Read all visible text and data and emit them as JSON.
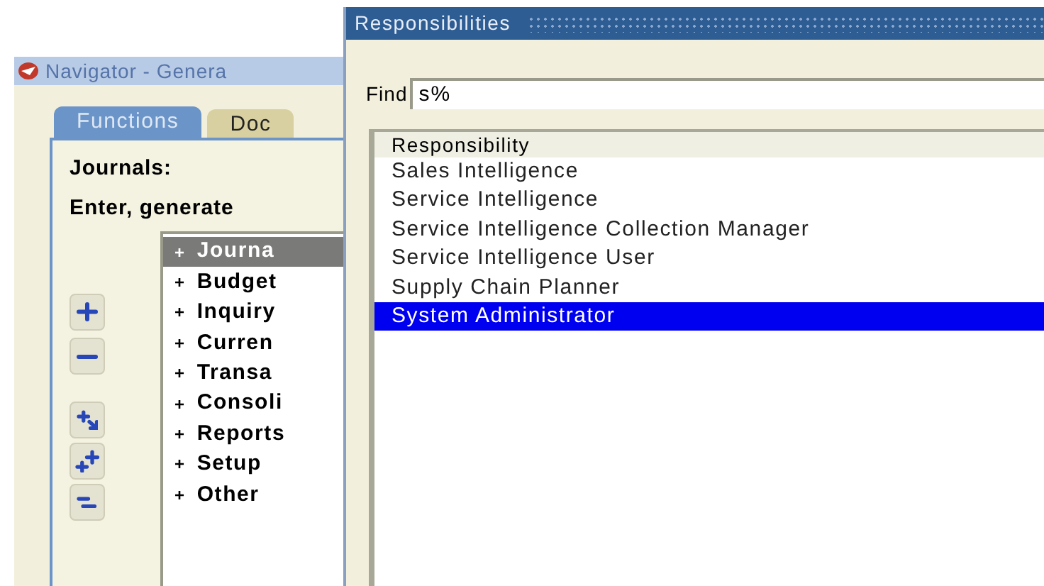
{
  "navigator": {
    "title": "Navigator - Genera",
    "tabs": [
      {
        "label": "Functions",
        "selected": true
      },
      {
        "label": "Doc",
        "selected": false
      }
    ],
    "heading": "Journals:",
    "description": "Enter, generate",
    "tree": [
      {
        "expander": "+",
        "label": "Journa",
        "selected": true
      },
      {
        "expander": "+",
        "label": "Budget",
        "selected": false
      },
      {
        "expander": "+",
        "label": "Inquiry",
        "selected": false
      },
      {
        "expander": "+",
        "label": "Curren",
        "selected": false
      },
      {
        "expander": "+",
        "label": "Transa",
        "selected": false
      },
      {
        "expander": "+",
        "label": "Consoli",
        "selected": false
      },
      {
        "expander": "+",
        "label": "Reports",
        "selected": false
      },
      {
        "expander": "+",
        "label": "Setup",
        "selected": false
      },
      {
        "expander": "+",
        "label": "Other",
        "selected": false
      }
    ],
    "tool_buttons": [
      {
        "kind": "expand"
      },
      {
        "kind": "collapse"
      },
      {
        "kind": "expand-branch"
      },
      {
        "kind": "expand-all"
      },
      {
        "kind": "collapse-all"
      }
    ]
  },
  "responsibilities": {
    "title": "Responsibilities",
    "find_label": "Find",
    "find_value": "s%",
    "column": "Responsibility",
    "rows": [
      {
        "label": "Sales Intelligence",
        "selected": false
      },
      {
        "label": "Service Intelligence",
        "selected": false
      },
      {
        "label": "Service Intelligence Collection Manager",
        "selected": false
      },
      {
        "label": "Service Intelligence User",
        "selected": false
      },
      {
        "label": "Supply Chain Planner",
        "selected": false
      },
      {
        "label": "System Administrator",
        "selected": true
      }
    ]
  }
}
